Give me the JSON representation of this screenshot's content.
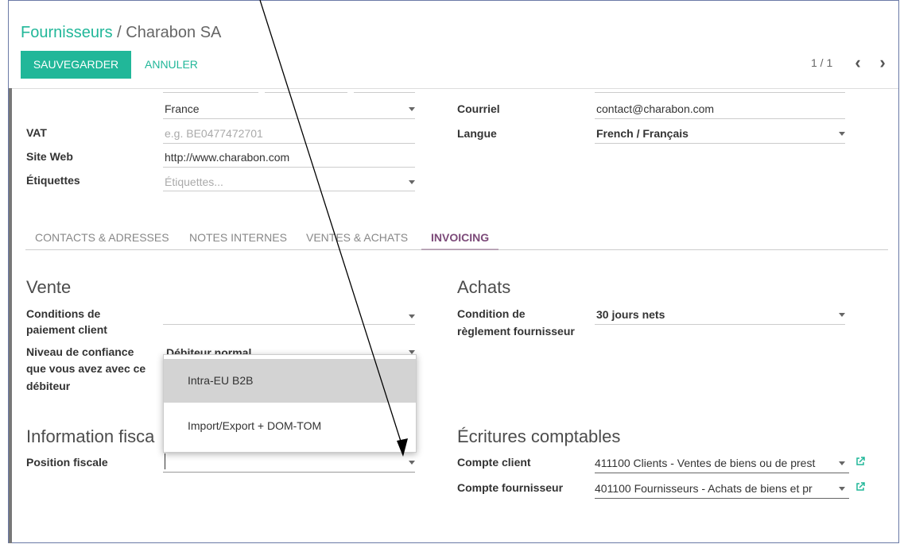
{
  "header": {
    "breadcrumb_parent": "Fournisseurs",
    "breadcrumb_sep": "/",
    "breadcrumb_current": "Charabon SA",
    "save_label": "SAUVEGARDER",
    "cancel_label": "ANNULER",
    "pager": "1 / 1"
  },
  "left_fields": {
    "country_value": "France",
    "vat_label": "VAT",
    "vat_placeholder": "e.g. BE0477472701",
    "website_label": "Site Web",
    "website_value": "http://www.charabon.com",
    "tags_label": "Étiquettes",
    "tags_placeholder": "Étiquettes..."
  },
  "right_fields": {
    "email_label": "Courriel",
    "email_value": "contact@charabon.com",
    "lang_label": "Langue",
    "lang_value": "French / Français"
  },
  "tabs": [
    {
      "label": "CONTACTS & ADRESSES"
    },
    {
      "label": "NOTES INTERNES"
    },
    {
      "label": "VENTES & ACHATS"
    },
    {
      "label": "INVOICING"
    }
  ],
  "vente": {
    "title": "Vente",
    "payment_label_1": "Conditions de",
    "payment_label_2": "paiement client",
    "trust_label_1": "Niveau de confiance",
    "trust_label_2": "que vous avez avec ce",
    "trust_label_3": "débiteur",
    "trust_value": "Débiteur normal"
  },
  "achats": {
    "title": "Achats",
    "cond_label_1": "Condition de",
    "cond_label_2": "règlement fournisseur",
    "cond_value": "30 jours nets"
  },
  "fiscal": {
    "title": "Information fisca",
    "position_label": "Position fiscale"
  },
  "ecritures": {
    "title": "Écritures comptables",
    "client_label": "Compte client",
    "client_value": "411100 Clients - Ventes de biens ou de prest",
    "supplier_label": "Compte fournisseur",
    "supplier_value": "401100 Fournisseurs - Achats de biens et pr"
  },
  "dropdown": {
    "items": [
      {
        "label": "Intra-EU B2B"
      },
      {
        "label": "Import/Export + DOM-TOM"
      }
    ]
  },
  "colors": {
    "accent": "#21b799",
    "tab_active": "#7c4a79"
  }
}
